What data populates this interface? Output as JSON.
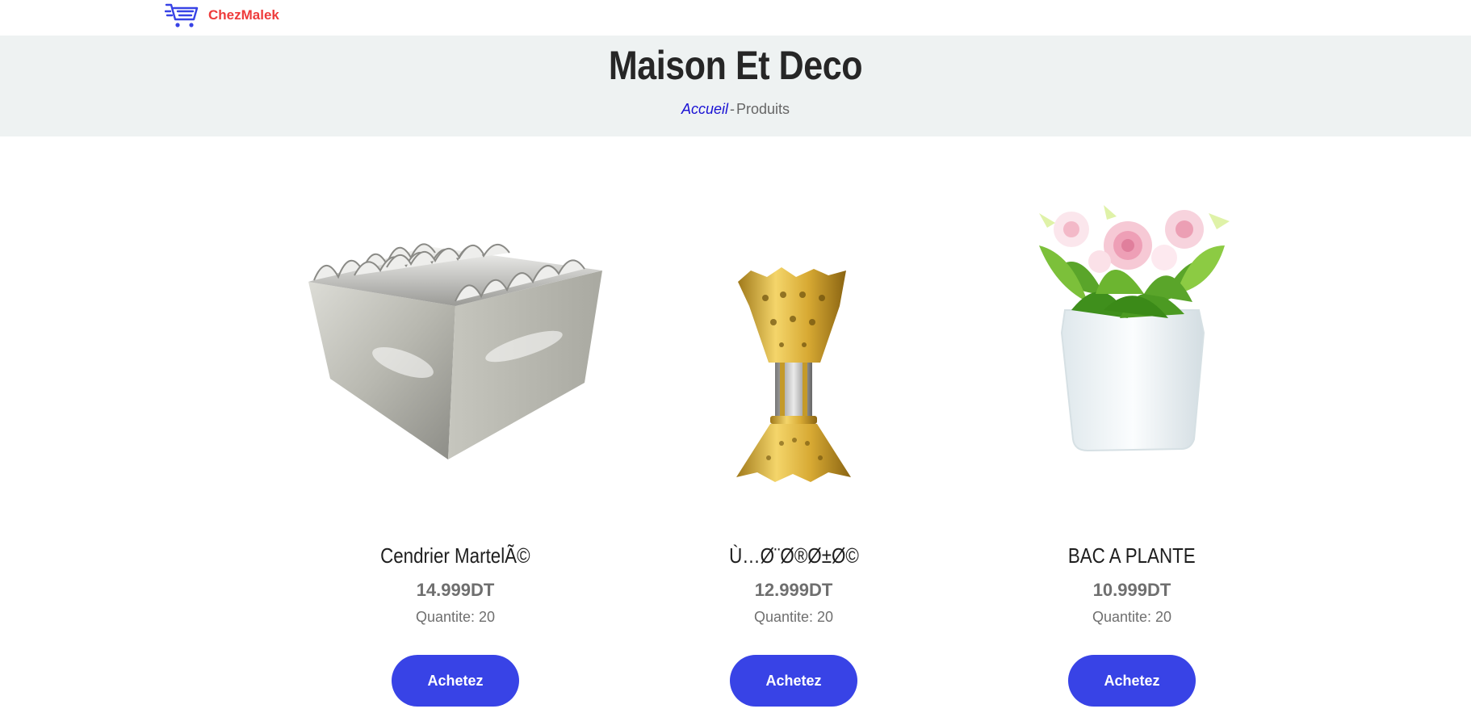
{
  "brand": {
    "name": "ChezMalek",
    "icon": "cart-icon"
  },
  "page": {
    "title": "Maison Et Deco",
    "breadcrumb": {
      "home": "Accueil",
      "separator": "-",
      "current": "Produits"
    }
  },
  "products": [
    {
      "name": "Cendrier MartelÃ©",
      "price": "14.999DT",
      "quantity": "Quantite: 20",
      "button": "Achetez",
      "image": "ashtray-image"
    },
    {
      "name": "Ù…Ø¨Ø®Ø±Ø©",
      "price": "12.999DT",
      "quantity": "Quantite: 20",
      "button": "Achetez",
      "image": "incense-burner-image"
    },
    {
      "name": "BAC A PLANTE",
      "price": "10.999DT",
      "quantity": "Quantite: 20",
      "button": "Achetez",
      "image": "plant-pot-image"
    }
  ],
  "colors": {
    "accent": "#3843e6",
    "brand": "#ee3b3b",
    "link": "#1a12d4",
    "hero_bg": "#eef2f2"
  }
}
